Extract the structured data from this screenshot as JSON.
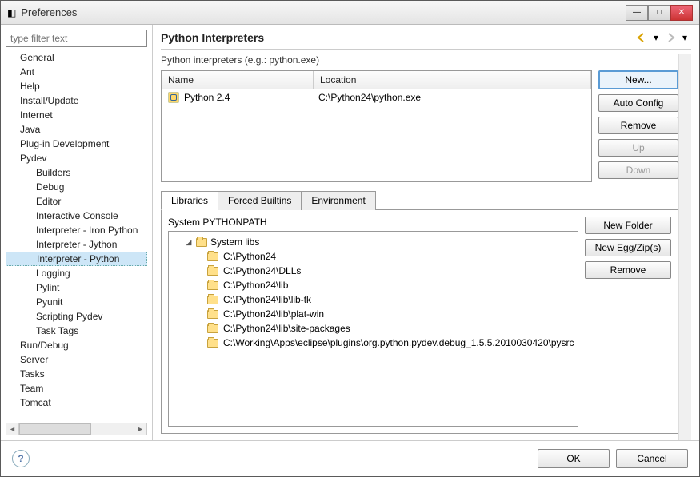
{
  "window": {
    "title": "Preferences"
  },
  "filter": {
    "placeholder": "type filter text"
  },
  "tree": [
    {
      "label": "General",
      "lvl": 0
    },
    {
      "label": "Ant",
      "lvl": 0
    },
    {
      "label": "Help",
      "lvl": 0
    },
    {
      "label": "Install/Update",
      "lvl": 0
    },
    {
      "label": "Internet",
      "lvl": 0
    },
    {
      "label": "Java",
      "lvl": 0
    },
    {
      "label": "Plug-in Development",
      "lvl": 0
    },
    {
      "label": "Pydev",
      "lvl": 0
    },
    {
      "label": "Builders",
      "lvl": 1
    },
    {
      "label": "Debug",
      "lvl": 1
    },
    {
      "label": "Editor",
      "lvl": 1
    },
    {
      "label": "Interactive Console",
      "lvl": 1
    },
    {
      "label": "Interpreter - Iron Python",
      "lvl": 1
    },
    {
      "label": "Interpreter - Jython",
      "lvl": 1
    },
    {
      "label": "Interpreter - Python",
      "lvl": 1,
      "selected": true
    },
    {
      "label": "Logging",
      "lvl": 1
    },
    {
      "label": "Pylint",
      "lvl": 1
    },
    {
      "label": "Pyunit",
      "lvl": 1
    },
    {
      "label": "Scripting Pydev",
      "lvl": 1
    },
    {
      "label": "Task Tags",
      "lvl": 1
    },
    {
      "label": "Run/Debug",
      "lvl": 0
    },
    {
      "label": "Server",
      "lvl": 0
    },
    {
      "label": "Tasks",
      "lvl": 0
    },
    {
      "label": "Team",
      "lvl": 0
    },
    {
      "label": "Tomcat",
      "lvl": 0
    }
  ],
  "page": {
    "title": "Python Interpreters",
    "subtitle": "Python interpreters (e.g.: python.exe)"
  },
  "table": {
    "col_name": "Name",
    "col_location": "Location",
    "rows": [
      {
        "name": "Python 2.4",
        "location": "C:\\Python24\\python.exe"
      }
    ]
  },
  "buttons": {
    "new": "New...",
    "auto_config": "Auto Config",
    "remove": "Remove",
    "up": "Up",
    "down": "Down",
    "new_folder": "New Folder",
    "new_egg": "New Egg/Zip(s)",
    "lib_remove": "Remove",
    "ok": "OK",
    "cancel": "Cancel"
  },
  "tabs": {
    "libraries": "Libraries",
    "forced": "Forced Builtins",
    "env": "Environment"
  },
  "libs": {
    "heading": "System PYTHONPATH",
    "root": "System libs",
    "items": [
      "C:\\Python24",
      "C:\\Python24\\DLLs",
      "C:\\Python24\\lib",
      "C:\\Python24\\lib\\lib-tk",
      "C:\\Python24\\lib\\plat-win",
      "C:\\Python24\\lib\\site-packages",
      "C:\\Working\\Apps\\eclipse\\plugins\\org.python.pydev.debug_1.5.5.2010030420\\pysrc"
    ]
  }
}
